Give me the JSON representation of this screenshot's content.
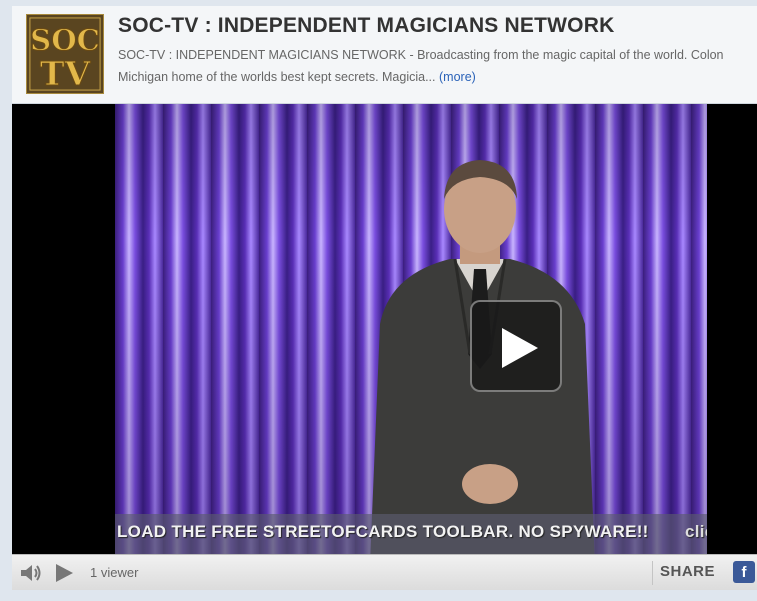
{
  "channel": {
    "title": "SOC-TV : INDEPENDENT MAGICIANS NETWORK",
    "description": "SOC-TV : INDEPENDENT MAGICIANS NETWORK - Broadcasting from the magic capital of the world. Colon Michigan home of the worlds best kept secrets. Magicia...",
    "more_label": "(more)",
    "logo_text_top": "SOC",
    "logo_text_bottom": "TV"
  },
  "video": {
    "ticker_text": "LOAD THE FREE STREETOFCARDS TOOLBAR.  NO SPYWARE!!",
    "ticker_tail": "clic"
  },
  "controls": {
    "viewers": "1 viewer",
    "share_label": "SHARE",
    "facebook_label": "f"
  },
  "colors": {
    "link": "#2a62b8",
    "facebook": "#3b5998"
  }
}
